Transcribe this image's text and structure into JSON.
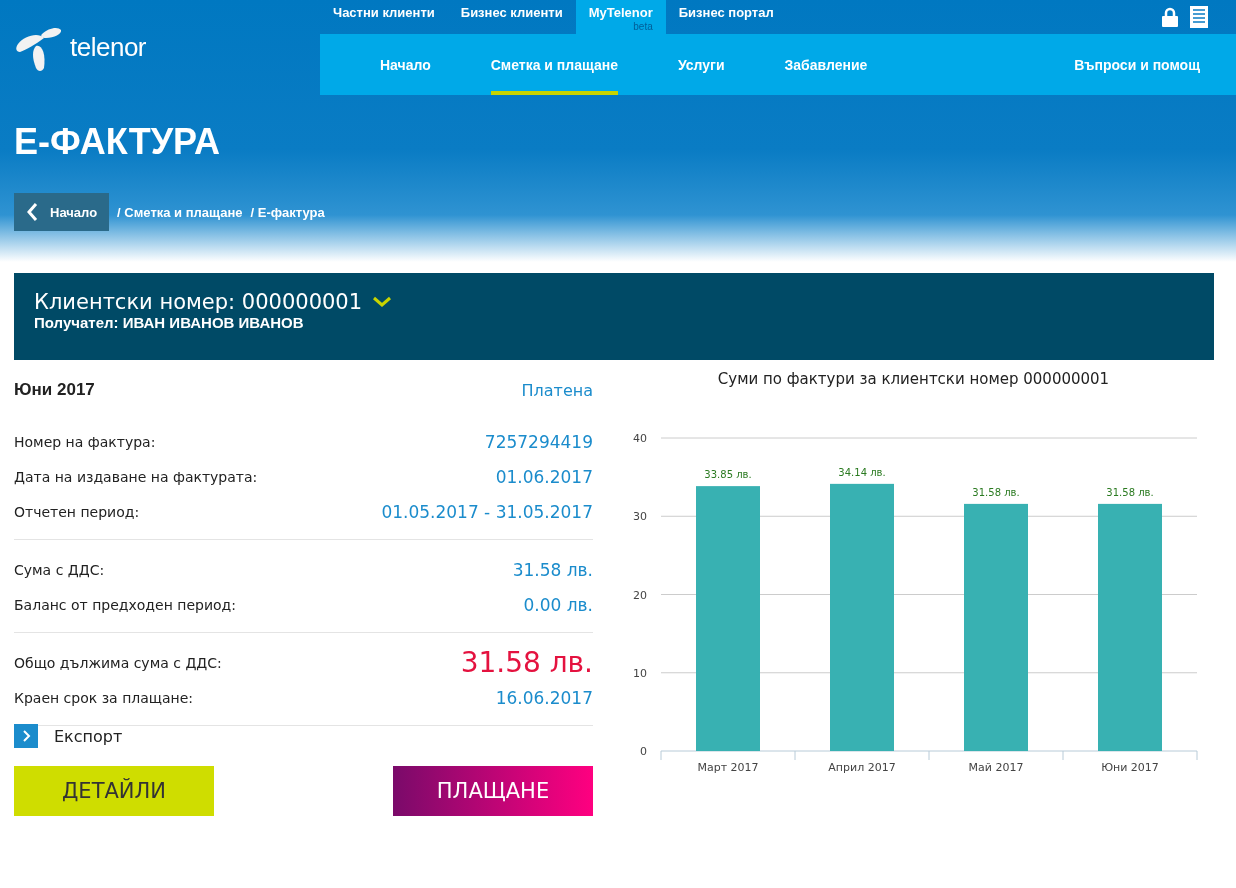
{
  "header": {
    "logo_text": "telenor",
    "top_nav": [
      {
        "label": "Частни клиенти",
        "selected": false
      },
      {
        "label": "Бизнес клиенти",
        "selected": false
      },
      {
        "label": "MyTelenor",
        "badge": "beta",
        "selected": true
      },
      {
        "label": "Бизнес портал",
        "selected": false
      }
    ],
    "sub_nav": [
      {
        "label": "Начало",
        "selected": false
      },
      {
        "label": "Сметка и плащане",
        "selected": true
      },
      {
        "label": "Услуги",
        "selected": false
      },
      {
        "label": "Забавление",
        "selected": false
      }
    ],
    "help_link": "Въпроси и помощ"
  },
  "page_title": "Е-ФАКТУРА",
  "breadcrumb": {
    "back": "Начало",
    "items": [
      "/ Сметка и плащане",
      "/ Е-фактура"
    ]
  },
  "customer": {
    "number": "Клиентски номер: 000000001",
    "recipient": "Получател: ИВАН ИВАНОВ ИВАНОВ"
  },
  "invoice": {
    "month": "Юни 2017",
    "status": "Платена",
    "groups": [
      [
        {
          "label": "Номер на фактура:",
          "value": "7257294419"
        },
        {
          "label": "Дата на издаване на фактурата:",
          "value": "01.06.2017"
        },
        {
          "label": "Отчетен период:",
          "value": "01.05.2017 - 31.05.2017"
        }
      ],
      [
        {
          "label": "Сума с ДДС:",
          "value": "31.58 лв."
        },
        {
          "label": "Баланс от предходен период:",
          "value": "0.00 лв."
        }
      ],
      [
        {
          "label": "Общо дължима сума с ДДС:",
          "value": "31.58 лв.",
          "kind": "total"
        },
        {
          "label": "Краен срок за плащане:",
          "value": "16.06.2017"
        }
      ]
    ],
    "export": "Експорт",
    "details_button": "ДЕТАЙЛИ",
    "pay_button": "ПЛАЩАНЕ"
  },
  "chart": {
    "chart_data": {
      "type": "bar",
      "title": "Суми по фактури за клиентски номер 000000001",
      "categories": [
        "Март 2017",
        "Април 2017",
        "Май 2017",
        "Юни 2017"
      ],
      "values": [
        33.85,
        34.14,
        31.58,
        31.58
      ],
      "value_labels": [
        "33.85 лв.",
        "34.14 лв.",
        "31.58 лв.",
        "31.58 лв."
      ],
      "grid": true,
      "ylim": [
        0,
        40
      ],
      "yticks": [
        0,
        10,
        20,
        30,
        40
      ]
    }
  }
}
